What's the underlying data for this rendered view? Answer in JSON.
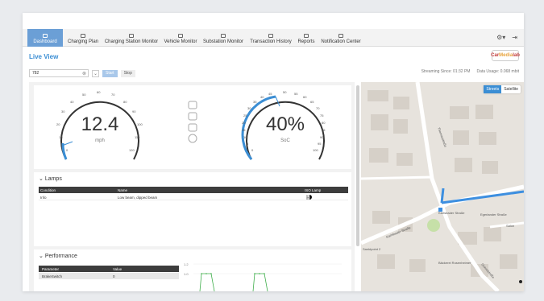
{
  "nav": {
    "items": [
      {
        "label": "Dashboard",
        "active": true
      },
      {
        "label": "Charging Plan"
      },
      {
        "label": "Charging Station Monitor"
      },
      {
        "label": "Vehicle Monitor"
      },
      {
        "label": "Substation Monitor"
      },
      {
        "label": "Transaction History"
      },
      {
        "label": "Reports"
      },
      {
        "label": "Notification Center"
      }
    ],
    "settings_icon": "gear-icon",
    "logout_icon": "logout-icon"
  },
  "page": {
    "title": "Live View"
  },
  "logo": {
    "part1": "Car",
    "part2": "Media",
    "part3": "lab"
  },
  "toolbar": {
    "vehicle_value": "782",
    "clear_icon": "close-icon",
    "dropdown_icon": "chevron-down-icon",
    "start_label": "Start",
    "stop_label": "Stop"
  },
  "stream": {
    "since": "Streaming Since: 01:32 PM",
    "usage": "Data Usage: 0.068 mbit"
  },
  "speed_gauge": {
    "value": "12.4",
    "unit": "mph",
    "ticks": [
      "0",
      "10",
      "20",
      "30",
      "40",
      "50",
      "60",
      "70",
      "80",
      "90",
      "100",
      "110",
      "120"
    ],
    "accent": "#3b8ed4"
  },
  "soc_gauge": {
    "value": "40%",
    "unit": "SoC",
    "ticks": [
      "0",
      "5",
      "10",
      "15",
      "20",
      "25",
      "30",
      "35",
      "40",
      "45",
      "50",
      "55",
      "60",
      "65",
      "70",
      "75",
      "80",
      "85",
      "90",
      "95",
      "100"
    ],
    "accent": "#3b8ed4"
  },
  "lamps": {
    "title": "Lamps",
    "columns": [
      "Condition",
      "Name",
      "ISO Lamp"
    ],
    "rows": [
      {
        "condition": "Info",
        "name": "Low beam, dipped beam"
      }
    ]
  },
  "performance": {
    "title": "Performance",
    "columns": [
      "Parameter",
      "Value"
    ],
    "rows": [
      {
        "parameter": "BrakeSwitch",
        "value": "0"
      }
    ],
    "chart_ticks": [
      "1.2",
      "1.0"
    ]
  },
  "map": {
    "streets_label": "Streets",
    "satellite_label": "Satellite",
    "labels": [
      "Thomasstraße",
      "Karlsbader Straße",
      "Karlsbader Straße",
      "Egerlander Straße",
      "Sanktpoint 2",
      "Gravelstraße",
      "Bäckerei Rosenheimer",
      "Salon"
    ]
  }
}
